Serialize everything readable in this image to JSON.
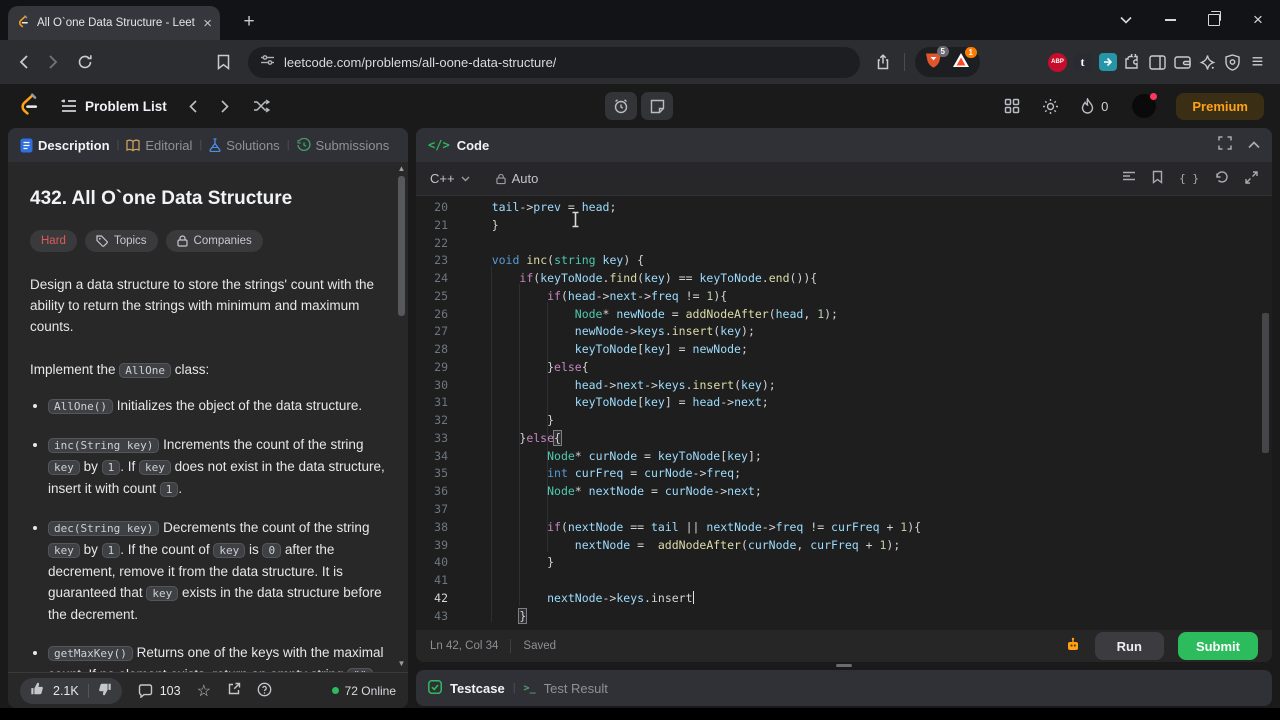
{
  "browser": {
    "tab_title": "All O`one Data Structure - Leet",
    "close_glyph": "×",
    "new_tab_glyph": "+",
    "url": "leetcode.com/problems/all-oone-data-structure/",
    "shields_badge": "5",
    "rewards_badge": "1",
    "extension_letters": {
      "abp": "ABP",
      "tumblr": "t"
    },
    "menu_glyph": "≡"
  },
  "nav": {
    "problem_list": "Problem List",
    "streak_count": "0",
    "premium_label": "Premium"
  },
  "description_panel": {
    "tabs": [
      {
        "label": "Description"
      },
      {
        "label": "Editorial"
      },
      {
        "label": "Solutions"
      },
      {
        "label": "Submissions"
      }
    ],
    "title": "432. All O`one Data Structure",
    "difficulty": "Hard",
    "topics_label": "Topics",
    "companies_label": "Companies",
    "intro": "Design a data structure to store the strings' count with the ability to return the strings with minimum and maximum counts.",
    "implement": [
      {
        "t": "Implement the "
      },
      {
        "t": "AllOne",
        "chip": true
      },
      {
        "t": " class:"
      }
    ],
    "bullets": [
      [
        {
          "t": "AllOne()",
          "chip": true
        },
        {
          "t": " Initializes the object of the data structure."
        }
      ],
      [
        {
          "t": "inc(String key)",
          "chip": true
        },
        {
          "t": " Increments the count of the string "
        },
        {
          "t": "key",
          "chip": true
        },
        {
          "t": " by "
        },
        {
          "t": "1",
          "chip": true
        },
        {
          "t": ". If "
        },
        {
          "t": "key",
          "chip": true
        },
        {
          "t": " does not exist in the data structure, insert it with count "
        },
        {
          "t": "1",
          "chip": true
        },
        {
          "t": "."
        }
      ],
      [
        {
          "t": "dec(String key)",
          "chip": true
        },
        {
          "t": " Decrements the count of the string "
        },
        {
          "t": "key",
          "chip": true
        },
        {
          "t": " by "
        },
        {
          "t": "1",
          "chip": true
        },
        {
          "t": ". If the count of "
        },
        {
          "t": "key",
          "chip": true
        },
        {
          "t": " is "
        },
        {
          "t": "0",
          "chip": true
        },
        {
          "t": " after the decrement, remove it from the data structure. It is guaranteed that "
        },
        {
          "t": "key",
          "chip": true
        },
        {
          "t": " exists in the data structure before the decrement."
        }
      ],
      [
        {
          "t": "getMaxKey()",
          "chip": true
        },
        {
          "t": " Returns one of the keys with the maximal count. If no element exists, return an empty string "
        },
        {
          "t": "\"\"",
          "chip": true
        },
        {
          "t": "."
        }
      ]
    ],
    "footer": {
      "likes": "2.1K",
      "comments": "103",
      "online": "72 Online"
    }
  },
  "code_panel": {
    "header_label": "Code",
    "code_icon_glyph": "</>",
    "language": "C++",
    "autocomplete_label": "Auto",
    "braces_glyph": "{ }",
    "status": {
      "line_col": "Ln 42, Col 34",
      "save_state": "Saved"
    },
    "run_label": "Run",
    "submit_label": "Submit"
  },
  "console": {
    "testcase_label": "Testcase",
    "test_result_label": "Test Result",
    "terminal_glyph": ">_"
  },
  "code_editor": {
    "lines": [
      {
        "n": "20",
        "tokens": [
          [
            "pln",
            "    "
          ],
          [
            "var",
            "tail"
          ],
          [
            "pln",
            "->"
          ],
          [
            "var",
            "prev"
          ],
          [
            "pln",
            " = "
          ],
          [
            "var",
            "head"
          ],
          [
            "pln",
            ";"
          ]
        ]
      },
      {
        "n": "21",
        "tokens": [
          [
            "pln",
            "    }"
          ]
        ]
      },
      {
        "n": "22",
        "tokens": []
      },
      {
        "n": "23",
        "tokens": [
          [
            "pln",
            "    "
          ],
          [
            "kw",
            "void"
          ],
          [
            "pln",
            " "
          ],
          [
            "fn",
            "inc"
          ],
          [
            "pln",
            "("
          ],
          [
            "type",
            "string"
          ],
          [
            "pln",
            " "
          ],
          [
            "var",
            "key"
          ],
          [
            "pln",
            ") {"
          ]
        ]
      },
      {
        "n": "24",
        "tokens": [
          [
            "pln",
            "        "
          ],
          [
            "ctrl",
            "if"
          ],
          [
            "pln",
            "("
          ],
          [
            "var",
            "keyToNode"
          ],
          [
            "pln",
            "."
          ],
          [
            "fn",
            "find"
          ],
          [
            "pln",
            "("
          ],
          [
            "var",
            "key"
          ],
          [
            "pln",
            ") == "
          ],
          [
            "var",
            "keyToNode"
          ],
          [
            "pln",
            "."
          ],
          [
            "fn",
            "end"
          ],
          [
            "pln",
            "()){"
          ]
        ]
      },
      {
        "n": "25",
        "tokens": [
          [
            "pln",
            "            "
          ],
          [
            "ctrl",
            "if"
          ],
          [
            "pln",
            "("
          ],
          [
            "var",
            "head"
          ],
          [
            "pln",
            "->"
          ],
          [
            "var",
            "next"
          ],
          [
            "pln",
            "->"
          ],
          [
            "var",
            "freq"
          ],
          [
            "pln",
            " != "
          ],
          [
            "num",
            "1"
          ],
          [
            "pln",
            "){"
          ]
        ]
      },
      {
        "n": "26",
        "tokens": [
          [
            "pln",
            "                "
          ],
          [
            "type",
            "Node"
          ],
          [
            "pln",
            "* "
          ],
          [
            "var",
            "newNode"
          ],
          [
            "pln",
            " = "
          ],
          [
            "fn",
            "addNodeAfter"
          ],
          [
            "pln",
            "("
          ],
          [
            "var",
            "head"
          ],
          [
            "pln",
            ", "
          ],
          [
            "num",
            "1"
          ],
          [
            "pln",
            ");"
          ]
        ]
      },
      {
        "n": "27",
        "tokens": [
          [
            "pln",
            "                "
          ],
          [
            "var",
            "newNode"
          ],
          [
            "pln",
            "->"
          ],
          [
            "var",
            "keys"
          ],
          [
            "pln",
            "."
          ],
          [
            "fn",
            "insert"
          ],
          [
            "pln",
            "("
          ],
          [
            "var",
            "key"
          ],
          [
            "pln",
            ");"
          ]
        ]
      },
      {
        "n": "28",
        "tokens": [
          [
            "pln",
            "                "
          ],
          [
            "var",
            "keyToNode"
          ],
          [
            "pln",
            "["
          ],
          [
            "var",
            "key"
          ],
          [
            "pln",
            "] = "
          ],
          [
            "var",
            "newNode"
          ],
          [
            "pln",
            ";"
          ]
        ]
      },
      {
        "n": "29",
        "tokens": [
          [
            "pln",
            "            }"
          ],
          [
            "ctrl",
            "else"
          ],
          [
            "pln",
            "{"
          ]
        ]
      },
      {
        "n": "30",
        "tokens": [
          [
            "pln",
            "                "
          ],
          [
            "var",
            "head"
          ],
          [
            "pln",
            "->"
          ],
          [
            "var",
            "next"
          ],
          [
            "pln",
            "->"
          ],
          [
            "var",
            "keys"
          ],
          [
            "pln",
            "."
          ],
          [
            "fn",
            "insert"
          ],
          [
            "pln",
            "("
          ],
          [
            "var",
            "key"
          ],
          [
            "pln",
            ");"
          ]
        ]
      },
      {
        "n": "31",
        "tokens": [
          [
            "pln",
            "                "
          ],
          [
            "var",
            "keyToNode"
          ],
          [
            "pln",
            "["
          ],
          [
            "var",
            "key"
          ],
          [
            "pln",
            "] = "
          ],
          [
            "var",
            "head"
          ],
          [
            "pln",
            "->"
          ],
          [
            "var",
            "next"
          ],
          [
            "pln",
            ";"
          ]
        ]
      },
      {
        "n": "32",
        "tokens": [
          [
            "pln",
            "            }"
          ]
        ]
      },
      {
        "n": "33",
        "tokens": [
          [
            "pln",
            "        }"
          ],
          [
            "ctrl",
            "else"
          ],
          [
            "match",
            "{"
          ]
        ]
      },
      {
        "n": "34",
        "tokens": [
          [
            "pln",
            "            "
          ],
          [
            "type",
            "Node"
          ],
          [
            "pln",
            "* "
          ],
          [
            "var",
            "curNode"
          ],
          [
            "pln",
            " = "
          ],
          [
            "var",
            "keyToNode"
          ],
          [
            "pln",
            "["
          ],
          [
            "var",
            "key"
          ],
          [
            "pln",
            "];"
          ]
        ]
      },
      {
        "n": "35",
        "tokens": [
          [
            "pln",
            "            "
          ],
          [
            "kw",
            "int"
          ],
          [
            "pln",
            " "
          ],
          [
            "var",
            "curFreq"
          ],
          [
            "pln",
            " = "
          ],
          [
            "var",
            "curNode"
          ],
          [
            "pln",
            "->"
          ],
          [
            "var",
            "freq"
          ],
          [
            "pln",
            ";"
          ]
        ]
      },
      {
        "n": "36",
        "tokens": [
          [
            "pln",
            "            "
          ],
          [
            "type",
            "Node"
          ],
          [
            "pln",
            "* "
          ],
          [
            "var",
            "nextNode"
          ],
          [
            "pln",
            " = "
          ],
          [
            "var",
            "curNode"
          ],
          [
            "pln",
            "->"
          ],
          [
            "var",
            "next"
          ],
          [
            "pln",
            ";"
          ]
        ]
      },
      {
        "n": "37",
        "tokens": []
      },
      {
        "n": "38",
        "tokens": [
          [
            "pln",
            "            "
          ],
          [
            "ctrl",
            "if"
          ],
          [
            "pln",
            "("
          ],
          [
            "var",
            "nextNode"
          ],
          [
            "pln",
            " == "
          ],
          [
            "var",
            "tail"
          ],
          [
            "pln",
            " || "
          ],
          [
            "var",
            "nextNode"
          ],
          [
            "pln",
            "->"
          ],
          [
            "var",
            "freq"
          ],
          [
            "pln",
            " != "
          ],
          [
            "var",
            "curFreq"
          ],
          [
            "pln",
            " + "
          ],
          [
            "num",
            "1"
          ],
          [
            "pln",
            "){"
          ]
        ]
      },
      {
        "n": "39",
        "tokens": [
          [
            "pln",
            "                "
          ],
          [
            "var",
            "nextNode"
          ],
          [
            "pln",
            " =  "
          ],
          [
            "fn",
            "addNodeAfter"
          ],
          [
            "pln",
            "("
          ],
          [
            "var",
            "curNode"
          ],
          [
            "pln",
            ", "
          ],
          [
            "var",
            "curFreq"
          ],
          [
            "pln",
            " + "
          ],
          [
            "num",
            "1"
          ],
          [
            "pln",
            ");"
          ]
        ]
      },
      {
        "n": "40",
        "tokens": [
          [
            "pln",
            "            }"
          ]
        ]
      },
      {
        "n": "41",
        "tokens": []
      },
      {
        "n": "42",
        "active": true,
        "caret": true,
        "tokens": [
          [
            "pln",
            "            "
          ],
          [
            "var",
            "nextNode"
          ],
          [
            "pln",
            "->"
          ],
          [
            "var",
            "keys"
          ],
          [
            "pln",
            "."
          ],
          [
            "pln",
            "insert"
          ]
        ]
      },
      {
        "n": "43",
        "tokens": [
          [
            "pln",
            "        "
          ],
          [
            "match",
            "}"
          ]
        ]
      }
    ]
  },
  "colors": {
    "premium_orange": "#ffa116",
    "submit_green": "#2cbb5d",
    "hard_red": "#dd5a5d"
  }
}
